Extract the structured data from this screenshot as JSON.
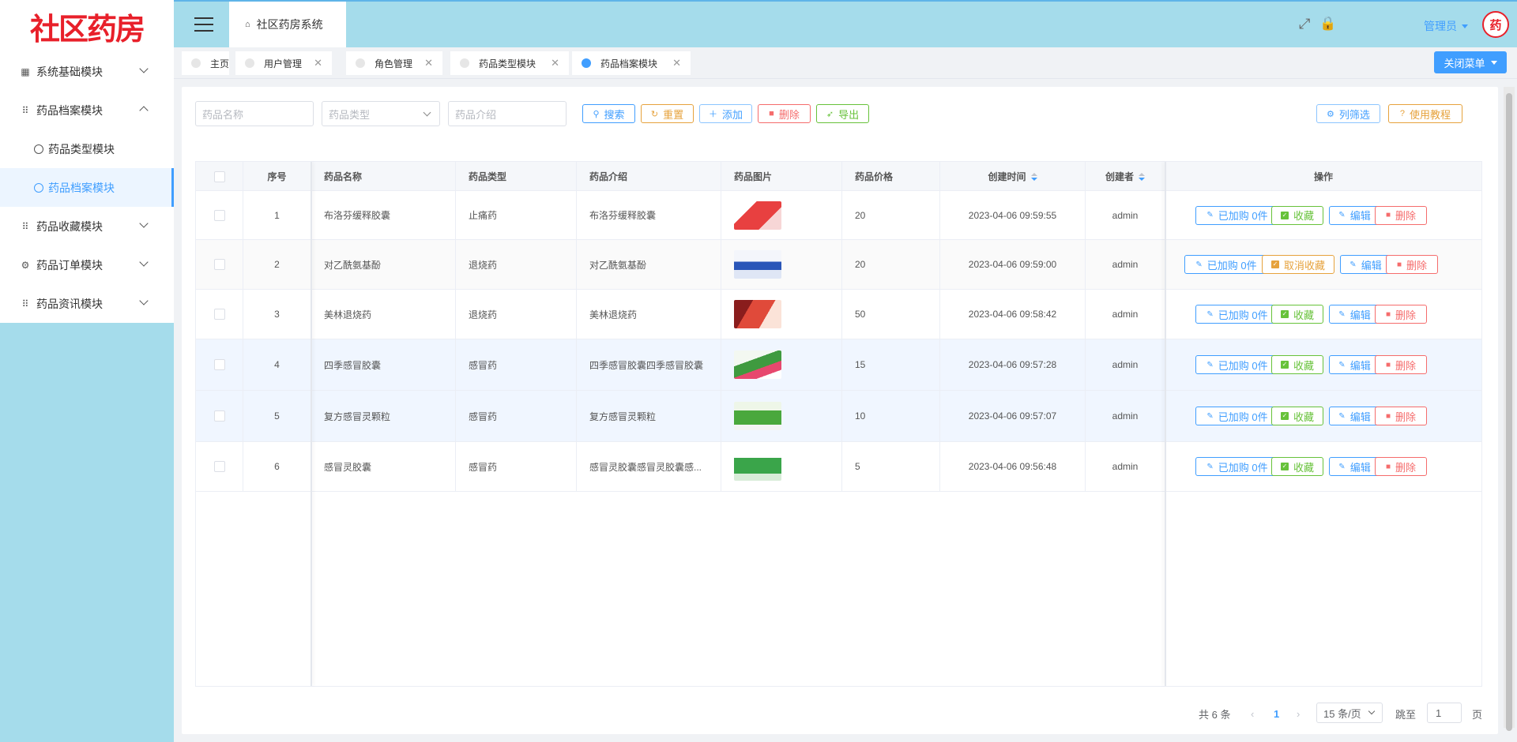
{
  "app": {
    "logo_text": "社区药房",
    "system_tab": "社区药房系统"
  },
  "sidebar": {
    "items": [
      {
        "label": "系统基础模块",
        "icon": "chart-icon",
        "expanded": false
      },
      {
        "label": "药品档案模块",
        "icon": "grid-icon",
        "expanded": true
      },
      {
        "label": "药品类型模块",
        "icon": "gear-icon",
        "sub": true
      },
      {
        "label": "药品档案模块",
        "icon": "gear-icon",
        "sub": true,
        "active": true
      },
      {
        "label": "药品收藏模块",
        "icon": "grid-icon",
        "expanded": false
      },
      {
        "label": "药品订单模块",
        "icon": "gear-icon",
        "expanded": false
      },
      {
        "label": "药品资讯模块",
        "icon": "grid-icon",
        "expanded": false
      }
    ]
  },
  "header": {
    "user_label": "管理员",
    "avatar_text": "药"
  },
  "tags": {
    "items": [
      "主页",
      "用户管理",
      "角色管理",
      "药品类型模块",
      "药品档案模块"
    ],
    "close_menu_label": "关闭菜单"
  },
  "filters": {
    "name_placeholder": "药品名称",
    "type_placeholder": "药品类型",
    "intro_placeholder": "药品介绍"
  },
  "toolbar": {
    "search": "搜索",
    "reset": "重置",
    "add": "添加",
    "delete": "删除",
    "export": "导出",
    "columns": "列筛选",
    "tutorial": "使用教程"
  },
  "table": {
    "headers": [
      "序号",
      "药品名称",
      "药品类型",
      "药品介绍",
      "药品图片",
      "药品价格",
      "创建时间",
      "创建者",
      "操作"
    ],
    "rows": [
      {
        "no": "1",
        "name": "布洛芬缓释胶囊",
        "type": "止痛药",
        "intro": "布洛芬缓释胶囊",
        "price": "20",
        "time": "2023-04-06 09:59:55",
        "creator": "admin",
        "cart": "已加购 0件",
        "fav": "收藏",
        "edit": "编辑",
        "del": "删除"
      },
      {
        "no": "2",
        "name": "对乙酰氨基酚",
        "type": "退烧药",
        "intro": "对乙酰氨基酚",
        "price": "20",
        "time": "2023-04-06 09:59:00",
        "creator": "admin",
        "cart": "已加购 0件",
        "fav": "取消收藏",
        "edit": "编辑",
        "del": "删除"
      },
      {
        "no": "3",
        "name": "美林退烧药",
        "type": "退烧药",
        "intro": "美林退烧药",
        "price": "50",
        "time": "2023-04-06 09:58:42",
        "creator": "admin",
        "cart": "已加购 0件",
        "fav": "收藏",
        "edit": "编辑",
        "del": "删除"
      },
      {
        "no": "4",
        "name": "四季感冒胶囊",
        "type": "感冒药",
        "intro": "四季感冒胶囊四季感冒胶囊",
        "price": "15",
        "time": "2023-04-06 09:57:28",
        "creator": "admin",
        "cart": "已加购 0件",
        "fav": "收藏",
        "edit": "编辑",
        "del": "删除"
      },
      {
        "no": "5",
        "name": "复方感冒灵颗粒",
        "type": "感冒药",
        "intro": "复方感冒灵颗粒",
        "price": "10",
        "time": "2023-04-06 09:57:07",
        "creator": "admin",
        "cart": "已加购 0件",
        "fav": "收藏",
        "edit": "编辑",
        "del": "删除"
      },
      {
        "no": "6",
        "name": "感冒灵胶囊",
        "type": "感冒药",
        "intro": "感冒灵胶囊感冒灵胶囊感...",
        "price": "5",
        "time": "2023-04-06 09:56:48",
        "creator": "admin",
        "cart": "已加购 0件",
        "fav": "收藏",
        "edit": "编辑",
        "del": "删除"
      }
    ]
  },
  "pagination": {
    "total": "共 6 条",
    "current": "1",
    "page_size": "15 条/页",
    "jump_label": "跳至",
    "jump_value": "1",
    "page_suffix": "页"
  },
  "colors": {
    "accent": "#409eff",
    "sidebar_bg": "#a5dceb",
    "logo_red": "#e8202a"
  }
}
